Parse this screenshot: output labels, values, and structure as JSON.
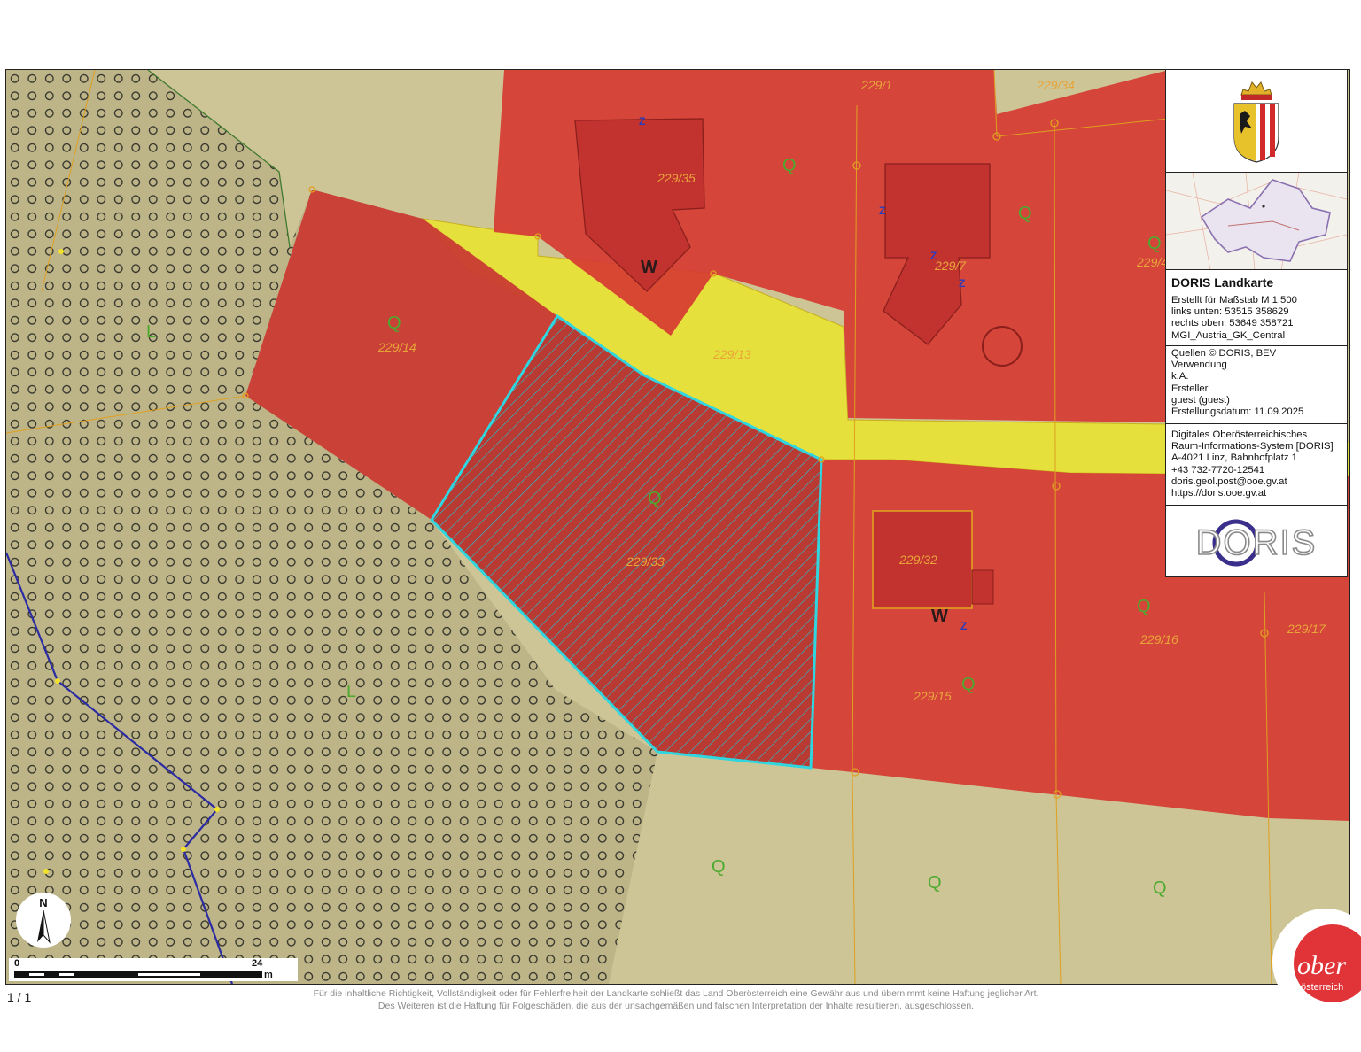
{
  "map": {
    "parcels": [
      {
        "id": "229/35"
      },
      {
        "id": "229/34"
      },
      {
        "id": "229/7"
      },
      {
        "id": "229/14"
      },
      {
        "id": "229/13"
      },
      {
        "id": "229/33"
      },
      {
        "id": "229/32"
      },
      {
        "id": "229/16"
      },
      {
        "id": "229/17"
      },
      {
        "id": "229/15"
      },
      {
        "id": "229/1"
      },
      {
        "id": "229/4"
      }
    ],
    "zone_q": "Q",
    "zone_w": "W",
    "zone_l": "L",
    "zone_z": "Z",
    "colors": {
      "residential": "#d63a32",
      "road": "#e8e23a",
      "agricultural": "#cfc796",
      "forest_pattern": "#4a4a3a",
      "selected_outline": "#2fd6e0",
      "boundary": "#e0a020",
      "water": "#2a2aa0"
    }
  },
  "info_panel": {
    "title": "DORIS Landkarte",
    "scale_line": "Erstellt für Maßstab M 1:500",
    "lower_left": "links unten: 53515 358629",
    "upper_right": "rechts oben: 53649 358721",
    "crs": "MGI_Austria_GK_Central",
    "sources": "Quellen © DORIS, BEV",
    "usage_label": "Verwendung",
    "usage_value": "k.A.",
    "creator_label": "Ersteller",
    "creator_value": "guest (guest)",
    "created_date": "Erstellungsdatum: 11.09.2025",
    "org_line1": "Digitales Oberösterreichisches",
    "org_line2": "Raum-Informations-System [DORIS]",
    "address": "A-4021 Linz, Bahnhofplatz 1",
    "phone": "+43 732-7720-12541",
    "email": "doris.geol.post@ooe.gv.at",
    "website": "https://doris.ooe.gv.at",
    "logo_text": "DORIS"
  },
  "north_arrow": {
    "label": "N"
  },
  "scalebar": {
    "start": "0",
    "end": "24",
    "unit": "m"
  },
  "footer": {
    "page": "1 / 1",
    "disclaimer_line1": "Für die inhaltliche Richtigkeit, Vollständigkeit oder für Fehlerfreiheit der Landkarte schließt das Land Oberösterreich eine Gewähr aus und übernimmt keine Haftung jeglicher Art.",
    "disclaimer_line2": "Des Weiteren ist die Haftung für Folgeschäden, die aus der unsachgemäßen und falschen Interpretation der Inhalte resultieren, ausgeschlossen.",
    "badge_line1": "ober",
    "badge_line2": "österreich"
  }
}
